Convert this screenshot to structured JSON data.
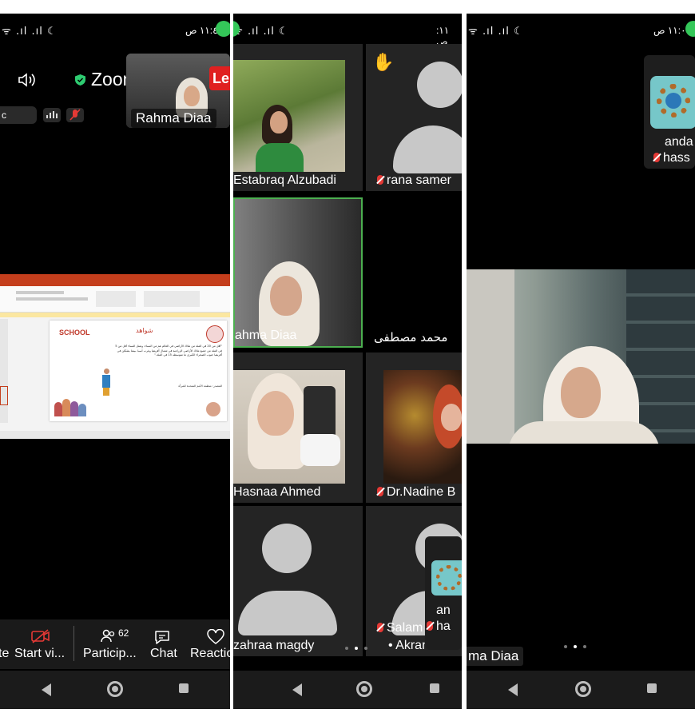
{
  "status": {
    "signal_glyphs": "ᯤ .ıl .ıl ☾",
    "p1_time": "١١:٤٢ ص",
    "p2_time": "١١: ص",
    "p3_time": "١١:٠٣ ص"
  },
  "phone1": {
    "app_title": "Zoom",
    "recording_label": "Le",
    "self_view_name": "Rahma Diaa",
    "toolbar": [
      {
        "label": "te",
        "icon": "end-icon"
      },
      {
        "label": "Start vi...",
        "icon": "video-off-icon"
      },
      {
        "label": "Particip...",
        "icon": "participants-icon",
        "badge": "62"
      },
      {
        "label": "Chat",
        "icon": "chat-icon"
      },
      {
        "label": "Reactio",
        "icon": "heart-icon"
      }
    ],
    "slide": {
      "heading": "شواهد",
      "school_logo": "SCHOOL",
      "body_text": "\"أقل من 20 في المئة من ملاك الأراضي في العالم هم من النساء، وتمثل النساء أقل من 5 في المئة من جميع ملاك الأراضي الزراعية في شمال أفريقيا وغرب آسيا، بينما يشكلن في أفريقيا جنوب الصحراء الكبرى ما متوسطه 15 في المئة.\"",
      "source_text": "المصدر: منظمة الأمم المتحدة للمرأة"
    }
  },
  "phone2": {
    "tiles": [
      {
        "name": "Estabraq Alzubadi",
        "muted": false
      },
      {
        "name": "rana samer",
        "muted": true,
        "hand_raised": true
      },
      {
        "name": "ahma Diaa",
        "muted": false,
        "active_speaker": true
      },
      {
        "name": "محمد مصطفى",
        "muted": false
      },
      {
        "name": "Hasnaa Ahmed",
        "muted": false
      },
      {
        "name": "Dr.Nadine B",
        "muted": true
      },
      {
        "name": "zahraa magdy",
        "muted": false
      },
      {
        "name": "Salam",
        "muted": true
      }
    ],
    "akran_label": "• Akran",
    "floating_name_1": "an",
    "floating_name_2": "ha",
    "hand_emoji": "✋"
  },
  "phone3": {
    "floating_name_1": "anda",
    "floating_name_2": "hass",
    "main_name": "ma Diaa"
  },
  "colors": {
    "background": "#000000",
    "tile": "#242424",
    "active_speaker_border": "#4caf50",
    "muted_red": "#e53935",
    "recording_red": "#e02020",
    "shield_green": "#2ecc71",
    "powerpoint_red": "#c43e1c"
  }
}
